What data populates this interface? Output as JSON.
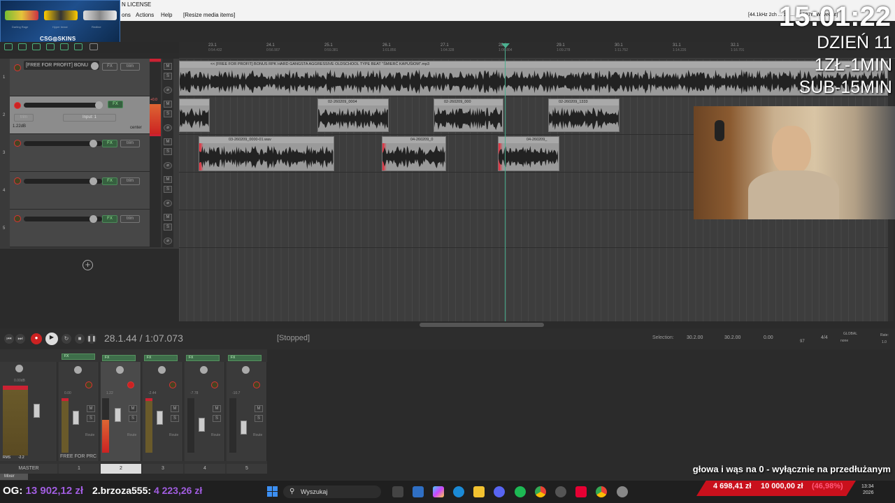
{
  "window": {
    "title_suffix": "N LICENSE"
  },
  "menu": {
    "items": [
      "ons",
      "Actions",
      "Help",
      "[Resize media items]"
    ],
    "right_status": "[44.1kHz 24bit WAV : 2/2ch 1024spls ~23/23ms WaveOut]",
    "right_status_short": "[44.1kHz 2ch ... 10 ... 4.. 187m WaveOut]"
  },
  "skins": {
    "logo": "CSG◎SKINS",
    "labels": [
      "Darling Rage",
      "Hyper beast",
      "Redline"
    ]
  },
  "ruler": {
    "ticks": [
      {
        "bar": "23.1",
        "time": "0:54.432"
      },
      {
        "bar": "24.1",
        "time": "0:56.907"
      },
      {
        "bar": "25.1",
        "time": "0:59.381"
      },
      {
        "bar": "26.1",
        "time": "1:01.856"
      },
      {
        "bar": "27.1",
        "time": "1:04.328"
      },
      {
        "bar": "28.1",
        "time": "1:06.804"
      },
      {
        "bar": "29.1",
        "time": "1:09.278"
      },
      {
        "bar": "30.1",
        "time": "1:11.752"
      },
      {
        "bar": "31.1",
        "time": "1:14.226"
      },
      {
        "bar": "32.1",
        "time": "1:16.701"
      }
    ]
  },
  "tracks": [
    {
      "num": "1",
      "name": "[FREE FOR PROFIT] BONU",
      "fx": "FX",
      "trim": "trim"
    },
    {
      "num": "2",
      "name": "",
      "fx": "FX",
      "trim": "trim",
      "input": "Input: 1",
      "gain": "1.22dB",
      "pan": "center",
      "meter_label": "+0.0"
    },
    {
      "num": "3",
      "name": "",
      "fx": "FX",
      "trim": "trim"
    },
    {
      "num": "4",
      "name": "",
      "fx": "FX",
      "trim": "trim"
    },
    {
      "num": "5",
      "name": "",
      "fx": "FX",
      "trim": "trim"
    }
  ],
  "media_items": {
    "lane1": "<< [FREE FOR PROFIT] BONUS RPK  HARD GANGSTA AGGRESSIVE OLDSCHOOL TYPE BEAT \"ŚMIERĆ KAPUŚIOM\".mp3",
    "lane2": [
      "",
      "02-260209_0004",
      "02-260209_000",
      "02-260209_1333"
    ],
    "lane3": [
      "03-260209_0000-01.wav",
      "04-260209_0",
      "04-260209_"
    ]
  },
  "transport": {
    "timecode": "28.1.44 / 1:07.073",
    "status": "[Stopped]",
    "selection_label": "Selection:",
    "sel_start": "30.2.00",
    "sel_end": "30.2.00",
    "sel_len": "0.00",
    "bpm": "97",
    "sig": "4/4",
    "global": "GLOBAL",
    "none": "none",
    "rate_label": "Rate:",
    "rate": "1.0"
  },
  "mixer": {
    "master_label": "MASTER",
    "master_db": "0.00dB",
    "rms": "RMS",
    "rms_val": "-2.2",
    "route": "Route",
    "strips": [
      {
        "num": "1",
        "name": "FREE FOR PRC",
        "db": "0.00",
        "peak": "+1.0"
      },
      {
        "num": "2",
        "name": "",
        "db": "1.22",
        "peak": "+0.0"
      },
      {
        "num": "3",
        "name": "",
        "db": "-2.44",
        "peak": "+1.2"
      },
      {
        "num": "4",
        "name": "",
        "db": "-7.78",
        "peak": "-10.3"
      },
      {
        "num": "5",
        "name": "",
        "db": "-10.7",
        "peak": "-10.7"
      }
    ],
    "tab": "Mixer"
  },
  "overlay": {
    "clock": "15:01:22",
    "day": "DZIEŃ 11",
    "rate1": "1ZŁ-1MIN",
    "rate2": "SUB-15MIN",
    "ticker": "głowa i wąs na 0 - wyłącznie na przedłużanym",
    "og_label": "OG:",
    "og_value": "13 902,12 zł",
    "leader_label": "2.brzoza555:",
    "leader_value": "4 223,26 zł",
    "don_current": "4 698,41 zł",
    "don_goal": "10 000,00 zł",
    "don_pct": "(46,98%)"
  },
  "taskbar": {
    "search_placeholder": "Wyszukaj",
    "time": "13:34",
    "date": "2026"
  },
  "colors": {
    "accent": "#4bb08f",
    "record": "#dd3333",
    "twitch_purple": "#a15de0",
    "donation_red": "#c9101c"
  }
}
